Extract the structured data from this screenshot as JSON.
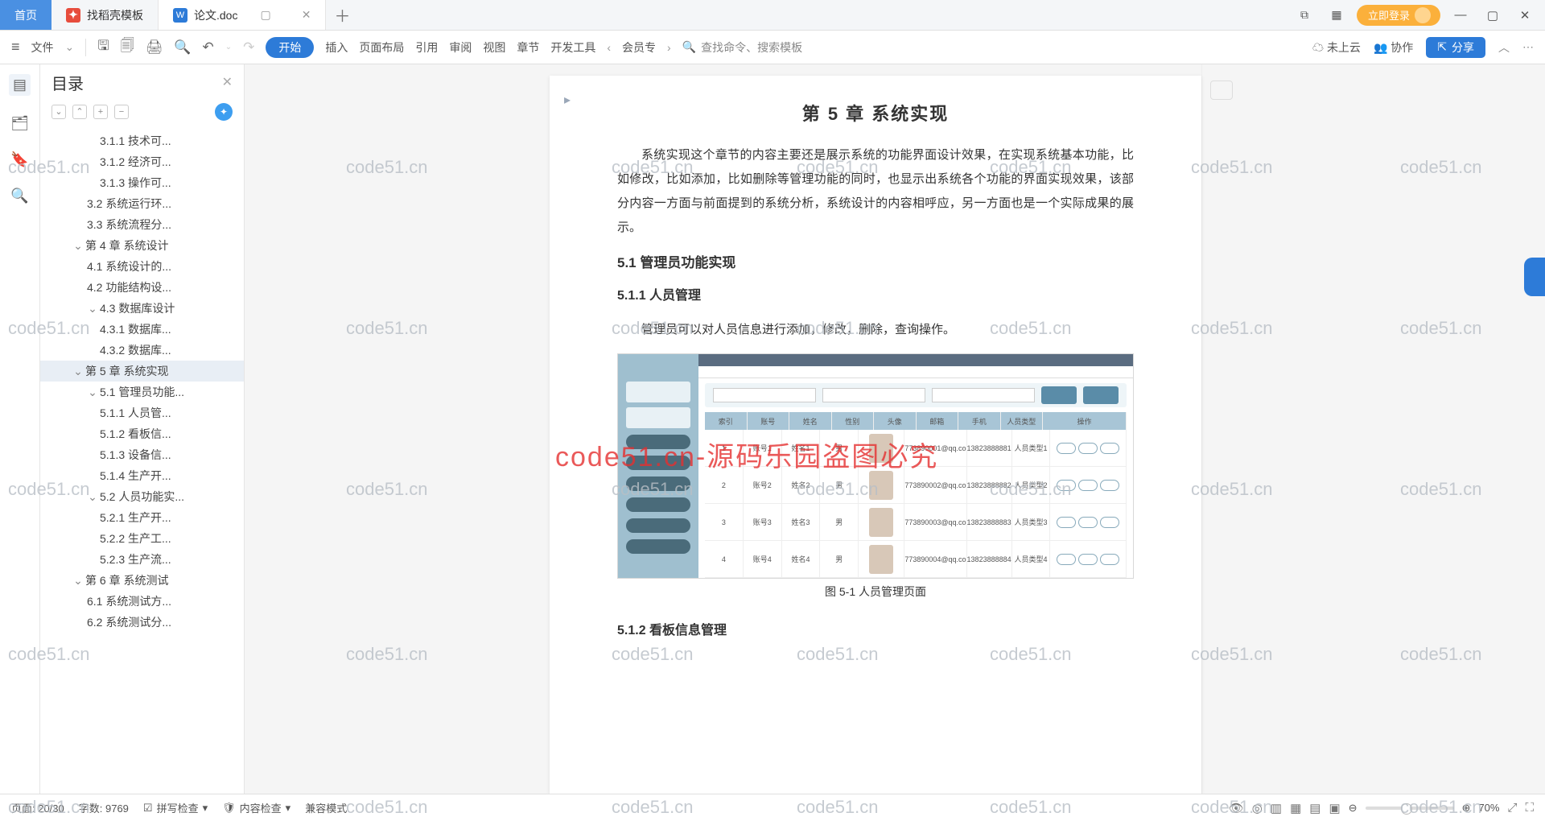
{
  "tabs": {
    "home": "首页",
    "template": "找稻壳模板",
    "doc": "论文.doc"
  },
  "login": "立即登录",
  "ribbon": {
    "file": "文件",
    "start": "开始",
    "insert": "插入",
    "layout": "页面布局",
    "ref": "引用",
    "review": "审阅",
    "view": "视图",
    "chapter": "章节",
    "dev": "开发工具",
    "member": "会员专",
    "search": "查找命令、搜索模板",
    "cloud": "未上云",
    "collab": "协作",
    "share": "分享"
  },
  "outline": {
    "title": "目录",
    "items": [
      {
        "lv": 4,
        "t": "3.1.1 技术可..."
      },
      {
        "lv": 4,
        "t": "3.1.2 经济可..."
      },
      {
        "lv": 4,
        "t": "3.1.3 操作可..."
      },
      {
        "lv": 3,
        "t": "3.2 系统运行环..."
      },
      {
        "lv": 3,
        "t": "3.3 系统流程分..."
      },
      {
        "lv": 2,
        "t": "第 4 章  系统设计",
        "tw": "⌄"
      },
      {
        "lv": 3,
        "t": "4.1 系统设计的..."
      },
      {
        "lv": 3,
        "t": "4.2 功能结构设..."
      },
      {
        "lv": 3,
        "t": "4.3 数据库设计",
        "tw": "⌄"
      },
      {
        "lv": 4,
        "t": "4.3.1 数据库..."
      },
      {
        "lv": 4,
        "t": "4.3.2 数据库..."
      },
      {
        "lv": 2,
        "t": "第 5 章  系统实现",
        "tw": "⌄",
        "active": true
      },
      {
        "lv": 3,
        "t": "5.1 管理员功能...",
        "tw": "⌄"
      },
      {
        "lv": 4,
        "t": "5.1.1 人员管..."
      },
      {
        "lv": 4,
        "t": "5.1.2 看板信..."
      },
      {
        "lv": 4,
        "t": "5.1.3 设备信..."
      },
      {
        "lv": 4,
        "t": "5.1.4 生产开..."
      },
      {
        "lv": 3,
        "t": "5.2 人员功能实...",
        "tw": "⌄"
      },
      {
        "lv": 4,
        "t": "5.2.1 生产开..."
      },
      {
        "lv": 4,
        "t": "5.2.2 生产工..."
      },
      {
        "lv": 4,
        "t": "5.2.3 生产流..."
      },
      {
        "lv": 2,
        "t": "第 6 章  系统测试",
        "tw": "⌄"
      },
      {
        "lv": 3,
        "t": "6.1 系统测试方..."
      },
      {
        "lv": 3,
        "t": "6.2 系统测试分..."
      }
    ]
  },
  "doc": {
    "h1": "第 5 章  系统实现",
    "p1": "系统实现这个章节的内容主要还是展示系统的功能界面设计效果，在实现系统基本功能，比如修改，比如添加，比如删除等管理功能的同时，也显示出系统各个功能的界面实现效果，该部分内容一方面与前面提到的系统分析，系统设计的内容相呼应，另一方面也是一个实际成果的展示。",
    "h2": "5.1 管理员功能实现",
    "h3a": "5.1.1  人员管理",
    "p2": "管理员可以对人员信息进行添加，修改，删除，查询操作。",
    "cap": "图 5-1  人员管理页面",
    "h3b": "5.1.2  看板信息管理"
  },
  "status": {
    "page": "页面: 20/30",
    "words": "字数: 9769",
    "spell": "拼写检查",
    "content": "内容检查",
    "compat": "兼容模式",
    "zoom": "70%"
  },
  "watermark": {
    "txt": "code51.cn",
    "bold": "code51.cn-源码乐园盗图必究"
  }
}
